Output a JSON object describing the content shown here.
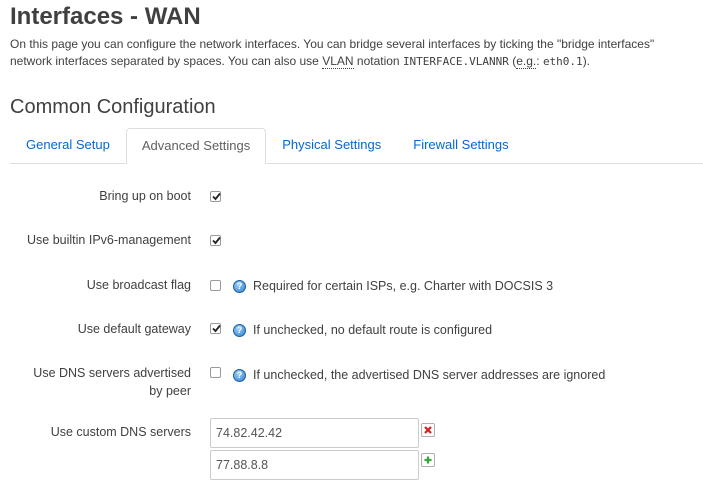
{
  "page": {
    "title": "Interfaces - WAN",
    "description": {
      "line1": "On this page you can configure the network interfaces. You can bridge several interfaces by ticking the \"bridge interfaces\"",
      "line2_pre": "network interfaces separated by spaces. You can also use ",
      "vlan": "VLAN",
      "line2_mid": " notation ",
      "notation": "INTERFACE.VLANNR",
      "line2_paren_open": " (",
      "eg": "e.g.",
      "eg_sep": ": ",
      "example": "eth0.1",
      "line2_end": ")."
    }
  },
  "section": {
    "title": "Common Configuration"
  },
  "tabs": [
    {
      "label": "General Setup",
      "active": false
    },
    {
      "label": "Advanced Settings",
      "active": true
    },
    {
      "label": "Physical Settings",
      "active": false
    },
    {
      "label": "Firewall Settings",
      "active": false
    }
  ],
  "fields": {
    "bring_up_on_boot": {
      "label": "Bring up on boot",
      "checked": true
    },
    "builtin_ipv6": {
      "label": "Use builtin IPv6-management",
      "checked": true
    },
    "broadcast_flag": {
      "label": "Use broadcast flag",
      "checked": false,
      "help": "Required for certain ISPs, e.g. Charter with DOCSIS 3"
    },
    "default_gateway": {
      "label": "Use default gateway",
      "checked": true,
      "help": "If unchecked, no default route is configured"
    },
    "peer_dns": {
      "label_line1": "Use DNS servers advertised",
      "label_line2": "by peer",
      "checked": false,
      "help": "If unchecked, the advertised DNS server addresses are ignored"
    },
    "custom_dns": {
      "label": "Use custom DNS servers",
      "values": [
        "74.82.42.42",
        "77.88.8.8"
      ]
    }
  },
  "icons": {
    "help": "help-icon",
    "remove": "remove-icon",
    "add": "add-icon"
  },
  "colors": {
    "link": "#0069d6",
    "remove_red": "#d81e1e",
    "add_green": "#3aa43a",
    "help_blue": "#2a7fd0"
  }
}
